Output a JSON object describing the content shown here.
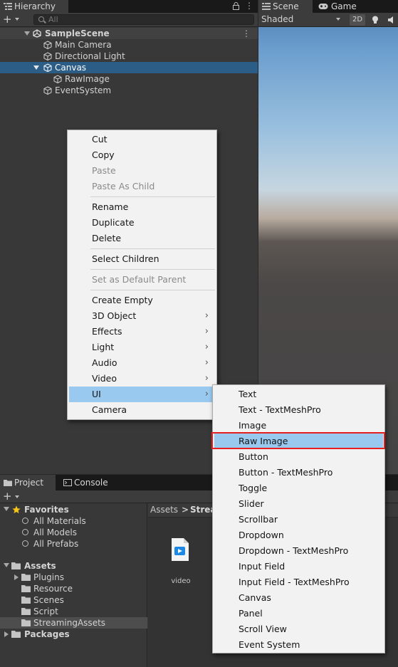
{
  "hierarchy": {
    "tab_label": "Hierarchy",
    "search_placeholder": "All",
    "scene_name": "SampleScene",
    "items": [
      {
        "label": "Main Camera"
      },
      {
        "label": "Directional Light"
      },
      {
        "label": "Canvas"
      },
      {
        "label": "RawImage"
      },
      {
        "label": "EventSystem"
      }
    ]
  },
  "scene_view": {
    "tab_scene": "Scene",
    "tab_game": "Game",
    "shading_mode": "Shaded",
    "mode_2d": "2D"
  },
  "context_menu": {
    "items": [
      {
        "label": "Cut"
      },
      {
        "label": "Copy"
      },
      {
        "label": "Paste"
      },
      {
        "label": "Paste As Child"
      },
      {
        "label": "Rename"
      },
      {
        "label": "Duplicate"
      },
      {
        "label": "Delete"
      },
      {
        "label": "Select Children"
      },
      {
        "label": "Set as Default Parent"
      },
      {
        "label": "Create Empty"
      },
      {
        "label": "3D Object"
      },
      {
        "label": "Effects"
      },
      {
        "label": "Light"
      },
      {
        "label": "Audio"
      },
      {
        "label": "Video"
      },
      {
        "label": "UI"
      },
      {
        "label": "Camera"
      }
    ]
  },
  "ui_submenu": {
    "items": [
      {
        "label": "Text"
      },
      {
        "label": "Text - TextMeshPro"
      },
      {
        "label": "Image"
      },
      {
        "label": "Raw Image"
      },
      {
        "label": "Button"
      },
      {
        "label": "Button - TextMeshPro"
      },
      {
        "label": "Toggle"
      },
      {
        "label": "Slider"
      },
      {
        "label": "Scrollbar"
      },
      {
        "label": "Dropdown"
      },
      {
        "label": "Dropdown - TextMeshPro"
      },
      {
        "label": "Input Field"
      },
      {
        "label": "Input Field - TextMeshPro"
      },
      {
        "label": "Canvas"
      },
      {
        "label": "Panel"
      },
      {
        "label": "Scroll View"
      },
      {
        "label": "Event System"
      }
    ]
  },
  "project": {
    "tab_project": "Project",
    "tab_console": "Console",
    "favorites_label": "Favorites",
    "favorites": [
      {
        "label": "All Materials"
      },
      {
        "label": "All Models"
      },
      {
        "label": "All Prefabs"
      }
    ],
    "assets_label": "Assets",
    "asset_folders": [
      {
        "label": "Plugins"
      },
      {
        "label": "Resource"
      },
      {
        "label": "Scenes"
      },
      {
        "label": "Script"
      },
      {
        "label": "StreamingAssets"
      }
    ],
    "packages_label": "Packages",
    "breadcrumb": [
      {
        "label": "Assets"
      },
      {
        "label": "Strea"
      }
    ],
    "asset_video_label": "video"
  },
  "colors": {
    "selection_blue": "#2c5d87",
    "menu_highlight": "#99c9ef",
    "annotation_red": "#e62020",
    "favorite_star": "#f5c518"
  }
}
